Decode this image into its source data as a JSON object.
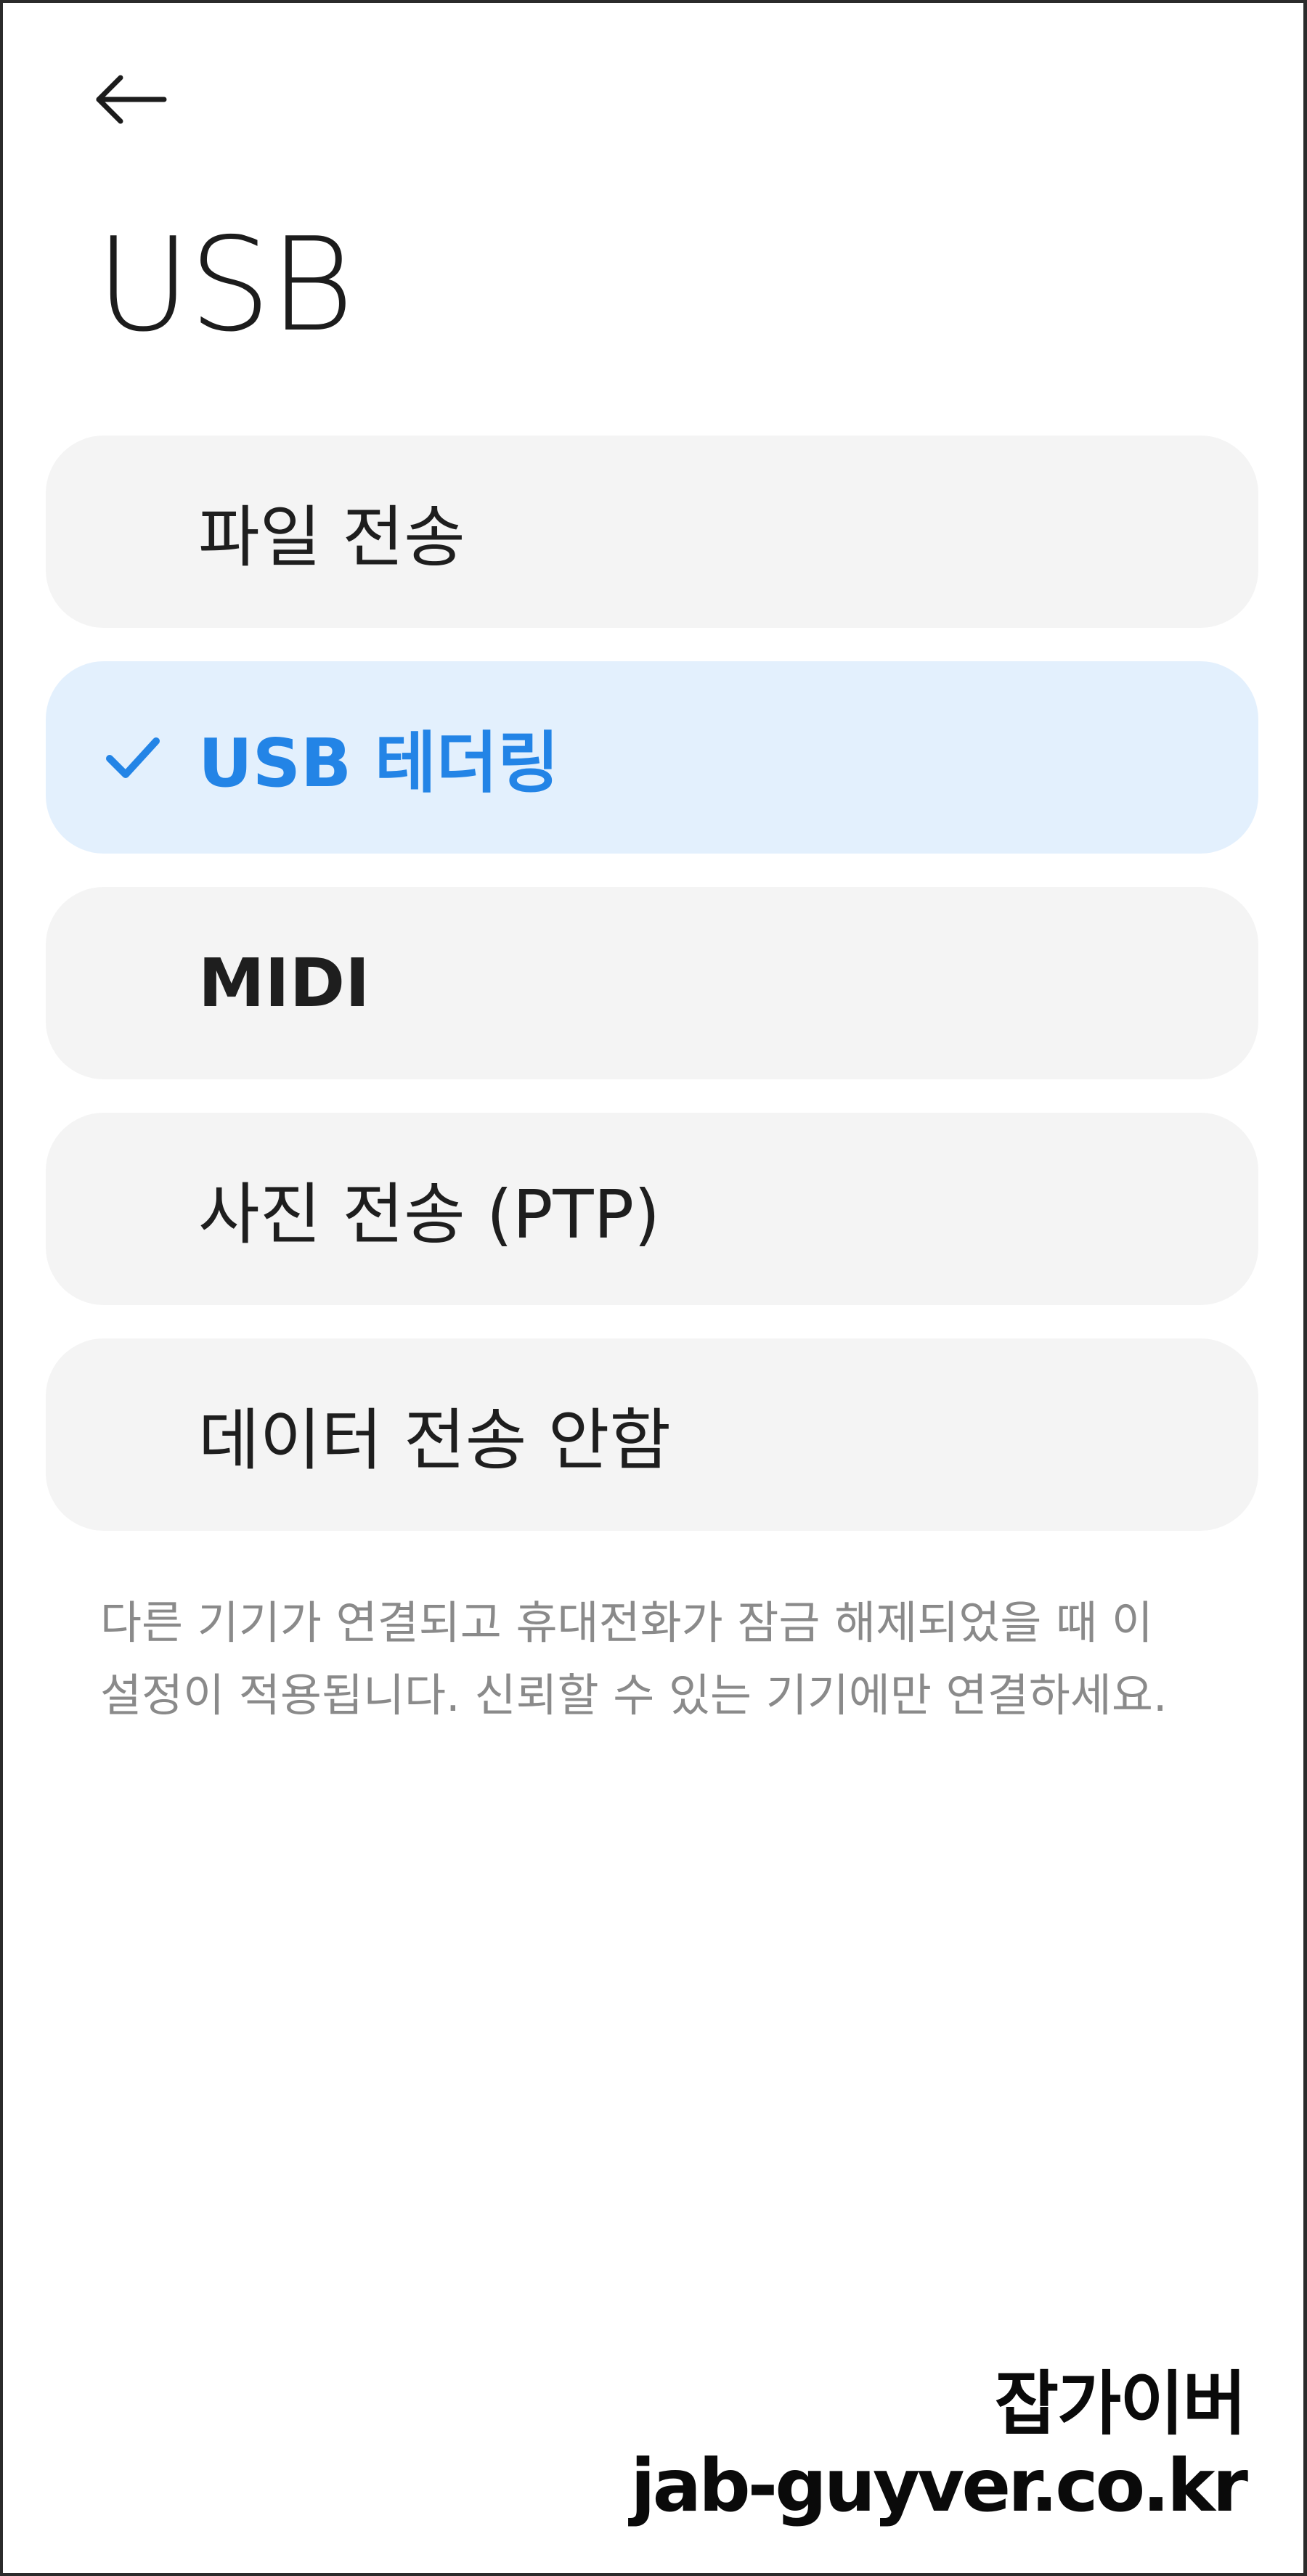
{
  "header": {
    "back_icon": "arrow-left-icon",
    "title": "USB"
  },
  "options": [
    {
      "label": "파일 전송",
      "selected": false,
      "bold": false
    },
    {
      "label": "USB 테더링",
      "selected": true,
      "bold": true
    },
    {
      "label": "MIDI",
      "selected": false,
      "bold": true
    },
    {
      "label": "사진 전송 (PTP)",
      "selected": false,
      "bold": false
    },
    {
      "label": "데이터 전송 안함",
      "selected": false,
      "bold": false
    }
  ],
  "selected_icon": "checkmark-icon",
  "description": "다른 기기가 연결되고 휴대전화가 잠금 해제되었을 때 이 설정이 적용됩니다. 신뢰할 수 있는 기기에만 연결하세요.",
  "watermark": {
    "line1": "잡가이버",
    "line2": "jab-guyver.co.kr"
  },
  "colors": {
    "accent": "#2384e6",
    "selected_bg": "#e3f0fd",
    "option_bg": "#f4f4f4",
    "description_text": "#8a8a8a"
  }
}
